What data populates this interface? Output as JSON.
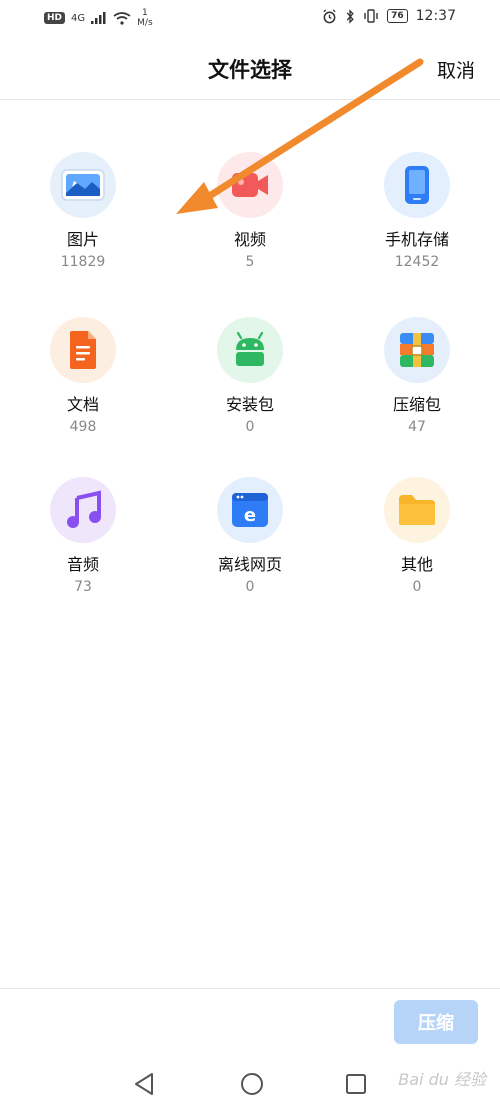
{
  "status_bar": {
    "hd": "HD",
    "signal": "4G",
    "speed_value": "1",
    "speed_unit": "M/s",
    "battery": "76",
    "time": "12:37"
  },
  "header": {
    "title": "文件选择",
    "cancel": "取消"
  },
  "categories": [
    {
      "label": "图片",
      "count": "11829",
      "icon": "image-icon"
    },
    {
      "label": "视频",
      "count": "5",
      "icon": "video-icon"
    },
    {
      "label": "手机存储",
      "count": "12452",
      "icon": "phone-storage-icon"
    },
    {
      "label": "文档",
      "count": "498",
      "icon": "document-icon"
    },
    {
      "label": "安装包",
      "count": "0",
      "icon": "android-icon"
    },
    {
      "label": "压缩包",
      "count": "47",
      "icon": "archive-icon"
    },
    {
      "label": "音频",
      "count": "73",
      "icon": "music-icon"
    },
    {
      "label": "离线网页",
      "count": "0",
      "icon": "webpage-icon"
    },
    {
      "label": "其他",
      "count": "0",
      "icon": "folder-icon"
    }
  ],
  "footer": {
    "compress": "压缩"
  },
  "watermark": "Bai du 经验",
  "colors": {
    "annotation_arrow": "#f08a2c",
    "compress_button": "#b6d4f7"
  }
}
